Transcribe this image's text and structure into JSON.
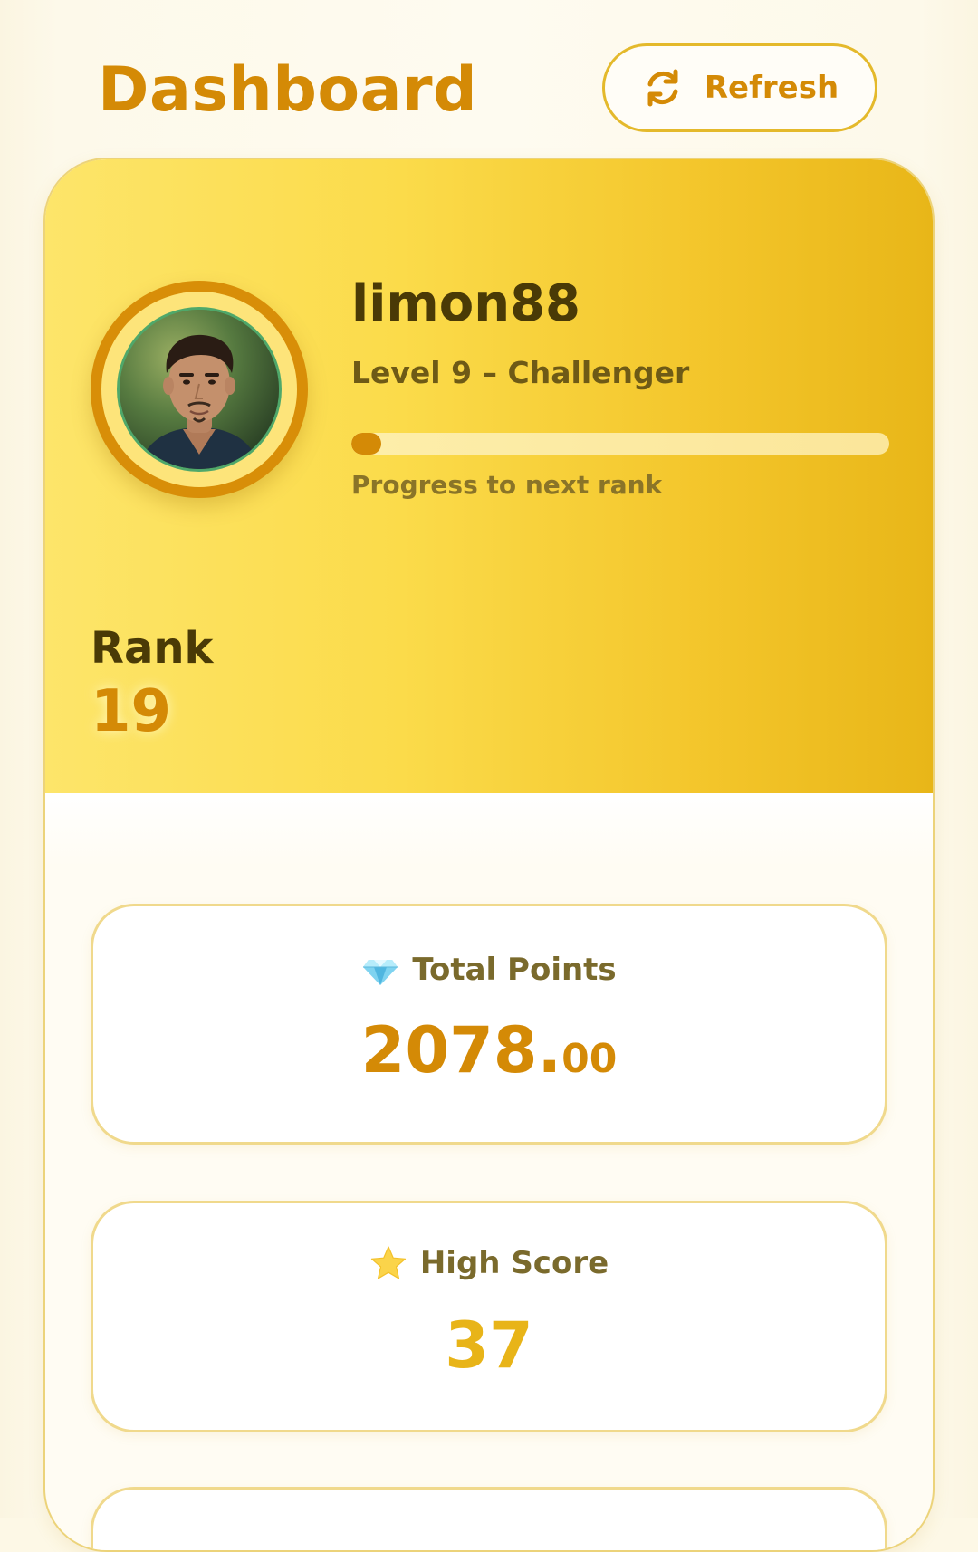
{
  "header": {
    "title": "Dashboard",
    "refresh_label": "Refresh",
    "refresh_icon": "refresh-icon"
  },
  "profile": {
    "username": "limon88",
    "level_text": "Level 9 – Challenger",
    "progress_caption": "Progress to next rank",
    "progress_fraction": 0.055,
    "rank_label": "Rank",
    "rank_value": "19",
    "avatar_icon": "user-avatar"
  },
  "stats": {
    "total_points": {
      "label": "Total Points",
      "icon": "gem-icon",
      "value_int": "2078.",
      "value_dec": "00"
    },
    "high_score": {
      "label": "High Score",
      "icon": "star-icon",
      "value": "37"
    }
  },
  "colors": {
    "accent": "#d48a06",
    "hero_start": "#fde56a",
    "hero_end": "#e8b618",
    "highscore": "#e8b418",
    "text_dark": "#4a3a06"
  }
}
